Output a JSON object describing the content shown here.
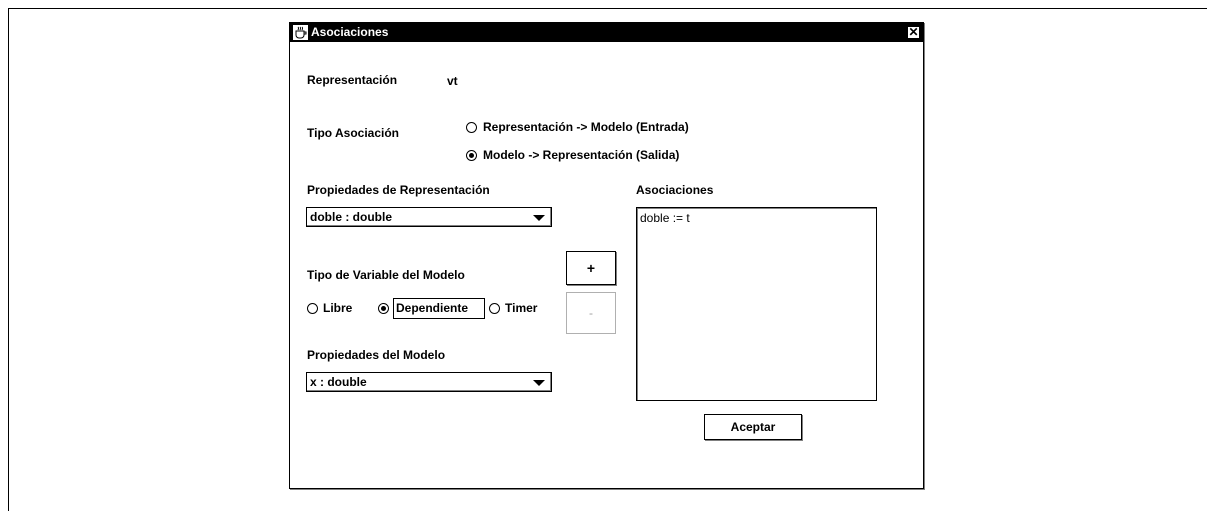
{
  "dialog": {
    "title": "Asociaciones",
    "close_symbol": "✕"
  },
  "representacion": {
    "label": "Representación",
    "value": "vt"
  },
  "tipo_asociacion": {
    "label": "Tipo Asociación",
    "options": [
      {
        "label": "Representación -> Modelo (Entrada)",
        "selected": false
      },
      {
        "label": "Modelo -> Representación (Salida)",
        "selected": true
      }
    ]
  },
  "propiedades_representacion": {
    "label": "Propiedades de Representación",
    "selected": "doble : double"
  },
  "tipo_variable": {
    "label": "Tipo de Variable del Modelo",
    "options": [
      {
        "label": "Libre",
        "selected": false
      },
      {
        "label": "Dependiente",
        "selected": true
      },
      {
        "label": "Timer",
        "selected": false
      }
    ]
  },
  "propiedades_modelo": {
    "label": "Propiedades del Modelo",
    "selected": "x : double"
  },
  "buttons": {
    "add": "+",
    "remove": "-",
    "accept": "Aceptar"
  },
  "asociaciones": {
    "label": "Asociaciones",
    "items": [
      "doble := t"
    ]
  },
  "icons": {
    "window": "java-cup-icon",
    "close": "close-icon",
    "dropdown": "chevron-down-icon"
  }
}
